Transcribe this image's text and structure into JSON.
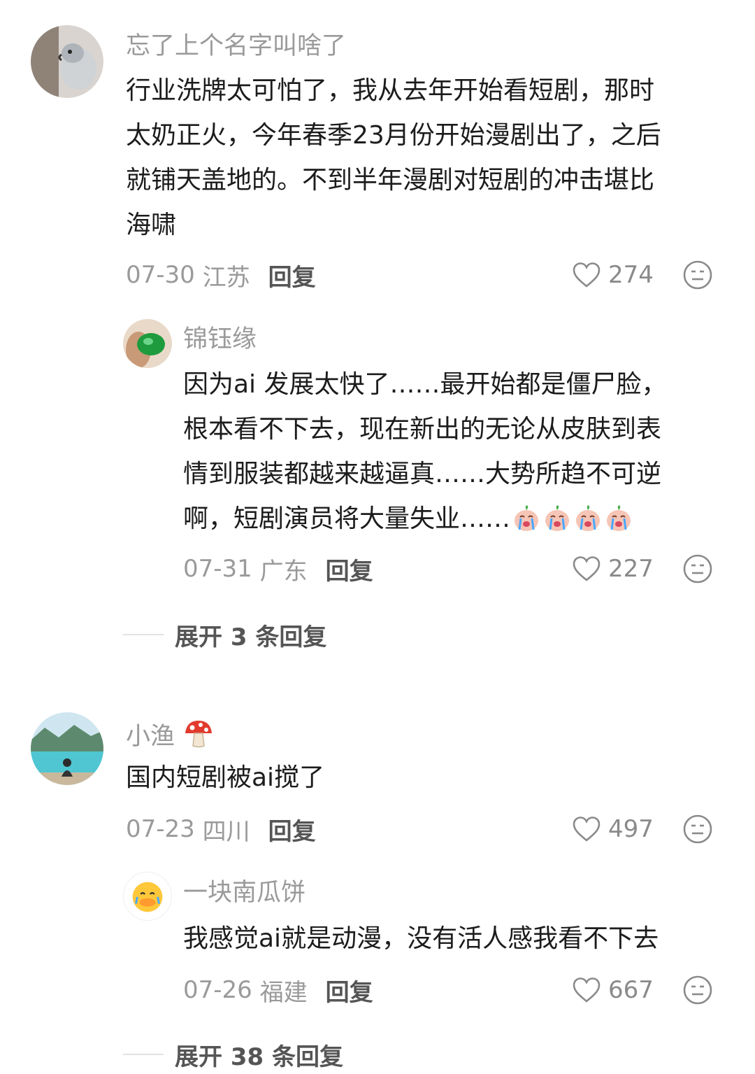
{
  "comments": [
    {
      "username": "忘了上个名字叫啥了",
      "text_lines": [
        "行业洗牌太可怕了，我从去年开始看短剧，那时",
        "太奶正火，今年春季23月份开始漫剧出了，之后",
        "就铺天盖地的。不到半年漫剧对短剧的冲击堪比",
        "海啸"
      ],
      "date": "07-30",
      "location": "江苏",
      "reply_label": "回复",
      "likes": "274",
      "reply": {
        "username": "锦钰缘",
        "text_lines": [
          "因为ai 发展太快了……最开始都是僵尸脸，",
          "根本看不下去，现在新出的无论从皮肤到表",
          "情到服装都越来越逼真……大势所趋不可逆",
          "啊，短剧演员将大量失业……"
        ],
        "emojis": [
          "crying-emoji",
          "crying-emoji",
          "crying-emoji",
          "crying-emoji"
        ],
        "date": "07-31",
        "location": "广东",
        "reply_label": "回复",
        "likes": "227"
      },
      "expand_label": "展开 3 条回复"
    },
    {
      "username": "小渔",
      "username_icon": "mushroom-icon",
      "text_lines": [
        "国内短剧被ai搅了"
      ],
      "date": "07-23",
      "location": "四川",
      "reply_label": "回复",
      "likes": "497",
      "reply": {
        "username": "一块南瓜饼",
        "text_lines": [
          "我感觉ai就是动漫，没有活人感我看不下去"
        ],
        "date": "07-26",
        "location": "福建",
        "reply_label": "回复",
        "likes": "667"
      },
      "expand_label": "展开 38 条回复"
    }
  ]
}
